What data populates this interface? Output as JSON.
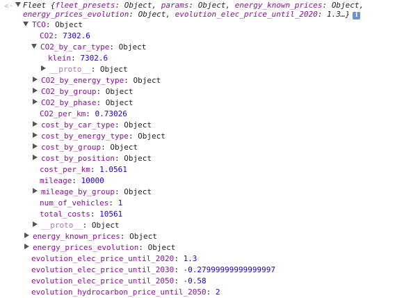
{
  "console": {
    "prompt_icon": "<·",
    "root": {
      "name": "Fleet",
      "preview_open": "{",
      "preview_items": [
        {
          "key": "fleet_presets",
          "value": "Object"
        },
        {
          "key": "params",
          "value": "Object"
        },
        {
          "key": "energy_known_prices",
          "value": "Object"
        },
        {
          "key": "energy_prices_evolution",
          "value": "Object"
        },
        {
          "key": "evolution_elec_price_until_2020",
          "value": "1.3"
        }
      ],
      "preview_close": "…}",
      "info_badge": "i"
    },
    "rows": [
      {
        "key": "TCO",
        "value": "Object",
        "type": "object",
        "expanded": true
      },
      {
        "key": "CO2",
        "value": "7302.6",
        "type": "number"
      },
      {
        "key": "CO2_by_car_type",
        "value": "Object",
        "type": "object",
        "expanded": true
      },
      {
        "key": "klein",
        "value": "7302.6",
        "type": "number"
      },
      {
        "key": "__proto__",
        "value": "Object",
        "type": "object",
        "expanded": false,
        "proto": true
      },
      {
        "key": "CO2_by_energy_type",
        "value": "Object",
        "type": "object",
        "expanded": false
      },
      {
        "key": "CO2_by_group",
        "value": "Object",
        "type": "object",
        "expanded": false
      },
      {
        "key": "CO2_by_phase",
        "value": "Object",
        "type": "object",
        "expanded": false
      },
      {
        "key": "CO2_per_km",
        "value": "0.73026",
        "type": "number"
      },
      {
        "key": "cost_by_car_type",
        "value": "Object",
        "type": "object",
        "expanded": false
      },
      {
        "key": "cost_by_energy_type",
        "value": "Object",
        "type": "object",
        "expanded": false
      },
      {
        "key": "cost_by_group",
        "value": "Object",
        "type": "object",
        "expanded": false
      },
      {
        "key": "cost_by_position",
        "value": "Object",
        "type": "object",
        "expanded": false
      },
      {
        "key": "cost_per_km",
        "value": "1.0561",
        "type": "number"
      },
      {
        "key": "mileage",
        "value": "10000",
        "type": "number"
      },
      {
        "key": "mileage_by_group",
        "value": "Object",
        "type": "object",
        "expanded": false
      },
      {
        "key": "num_of_vehicles",
        "value": "1",
        "type": "number"
      },
      {
        "key": "total_costs",
        "value": "10561",
        "type": "number"
      },
      {
        "key": "__proto__",
        "value": "Object",
        "type": "object",
        "expanded": false,
        "proto": true
      },
      {
        "key": "energy_known_prices",
        "value": "Object",
        "type": "object",
        "expanded": false
      },
      {
        "key": "energy_prices_evolution",
        "value": "Object",
        "type": "object",
        "expanded": false
      },
      {
        "key": "evolution_elec_price_until_2020",
        "value": "1.3",
        "type": "number"
      },
      {
        "key": "evolution_elec_price_until_2030",
        "value": "-0.27999999999999997",
        "type": "number"
      },
      {
        "key": "evolution_elec_price_until_2050",
        "value": "-0.58",
        "type": "number"
      },
      {
        "key": "evolution_hydrocarbon_price_until_2050",
        "value": "2",
        "type": "number"
      }
    ]
  }
}
